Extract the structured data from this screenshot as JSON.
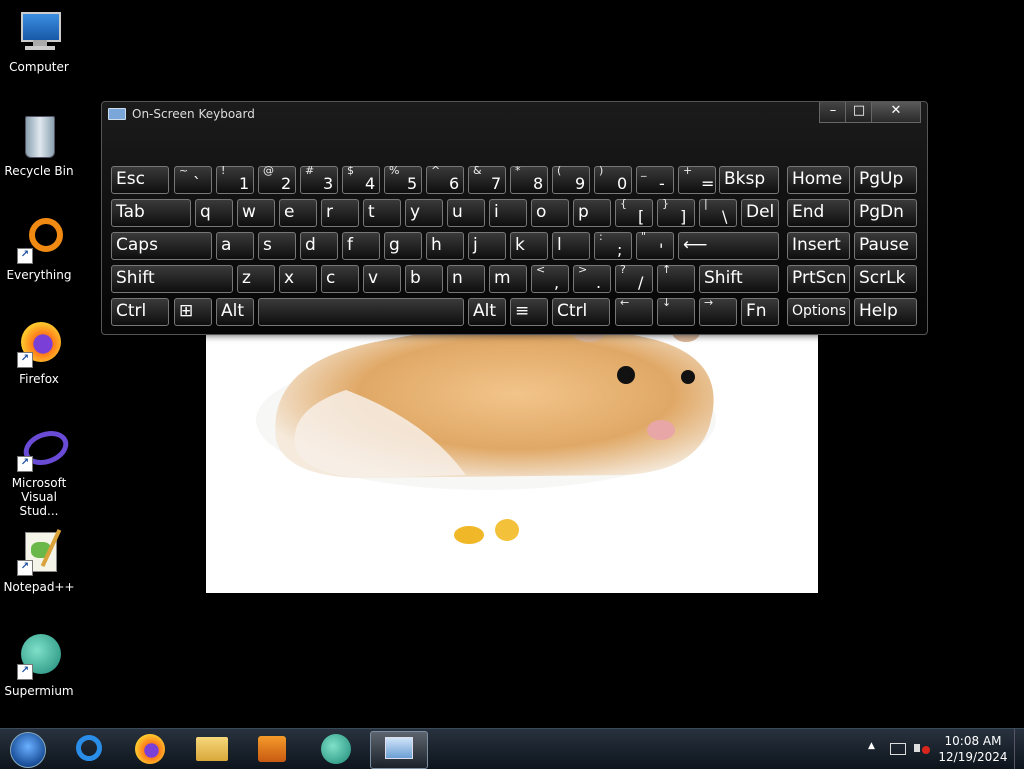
{
  "desktop": {
    "icons": [
      {
        "label": "Computer"
      },
      {
        "label": "Recycle Bin"
      },
      {
        "label": "Everything"
      },
      {
        "label": "Firefox"
      },
      {
        "label": "Microsoft Visual Stud..."
      },
      {
        "label": "Notepad++"
      },
      {
        "label": "Supermium"
      }
    ]
  },
  "osk": {
    "title": "On-Screen Keyboard",
    "controls": {
      "minimize": "–",
      "maximize": "□",
      "close": "✕"
    }
  },
  "keys": {
    "esc": "Esc",
    "tilde_up": "~",
    "tilde_dn": "`",
    "k1_up": "!",
    "k1": "1",
    "k2_up": "@",
    "k2": "2",
    "k3_up": "#",
    "k3": "3",
    "k4_up": "$",
    "k4": "4",
    "k5_up": "%",
    "k5": "5",
    "k6_up": "^",
    "k6": "6",
    "k7_up": "&",
    "k7": "7",
    "k8_up": "*",
    "k8": "8",
    "k9_up": "(",
    "k9": "9",
    "k0_up": ")",
    "k0": "0",
    "minus_up": "_",
    "minus": "-",
    "eq_up": "+",
    "eq": "=",
    "bksp": "Bksp",
    "home": "Home",
    "pgup": "PgUp",
    "tab": "Tab",
    "q": "q",
    "w": "w",
    "e": "e",
    "r": "r",
    "t": "t",
    "y": "y",
    "u": "u",
    "i": "i",
    "o": "o",
    "p": "p",
    "lbr_up": "{",
    "lbr": "[",
    "rbr_up": "}",
    "rbr": "]",
    "bsl_up": "|",
    "bsl": "\\",
    "del": "Del",
    "end": "End",
    "pgdn": "PgDn",
    "caps": "Caps",
    "a": "a",
    "s": "s",
    "d": "d",
    "f": "f",
    "g": "g",
    "h": "h",
    "j": "j",
    "k": "k",
    "l": "l",
    "semi_up": ":",
    "semi": ";",
    "quote_up": "\"",
    "quote": "'",
    "enter": "⟵",
    "insert": "Insert",
    "pause": "Pause",
    "shift": "Shift",
    "z": "z",
    "x": "x",
    "c": "c",
    "v": "v",
    "b": "b",
    "n": "n",
    "m": "m",
    "comma_up": "<",
    "comma": ",",
    "period_up": ">",
    "period": ".",
    "slash_up": "?",
    "slash": "/",
    "up": "↑",
    "shift_r": "Shift",
    "prtscn": "PrtScn",
    "scrlk": "ScrLk",
    "ctrl": "Ctrl",
    "win": "⊞",
    "alt": "Alt",
    "space": "",
    "alt_r": "Alt",
    "menu": "≡",
    "ctrl_r": "Ctrl",
    "left": "←",
    "down": "↓",
    "right": "→",
    "fn": "Fn",
    "options": "Options",
    "help": "Help"
  },
  "taskbar": {
    "clock_time": "10:08 AM",
    "clock_date": "12/19/2024",
    "tray_expand": "▲"
  },
  "colors": {
    "osk_bg": "#111111",
    "desktop": "#000000",
    "hamster": "#e7b77b"
  }
}
